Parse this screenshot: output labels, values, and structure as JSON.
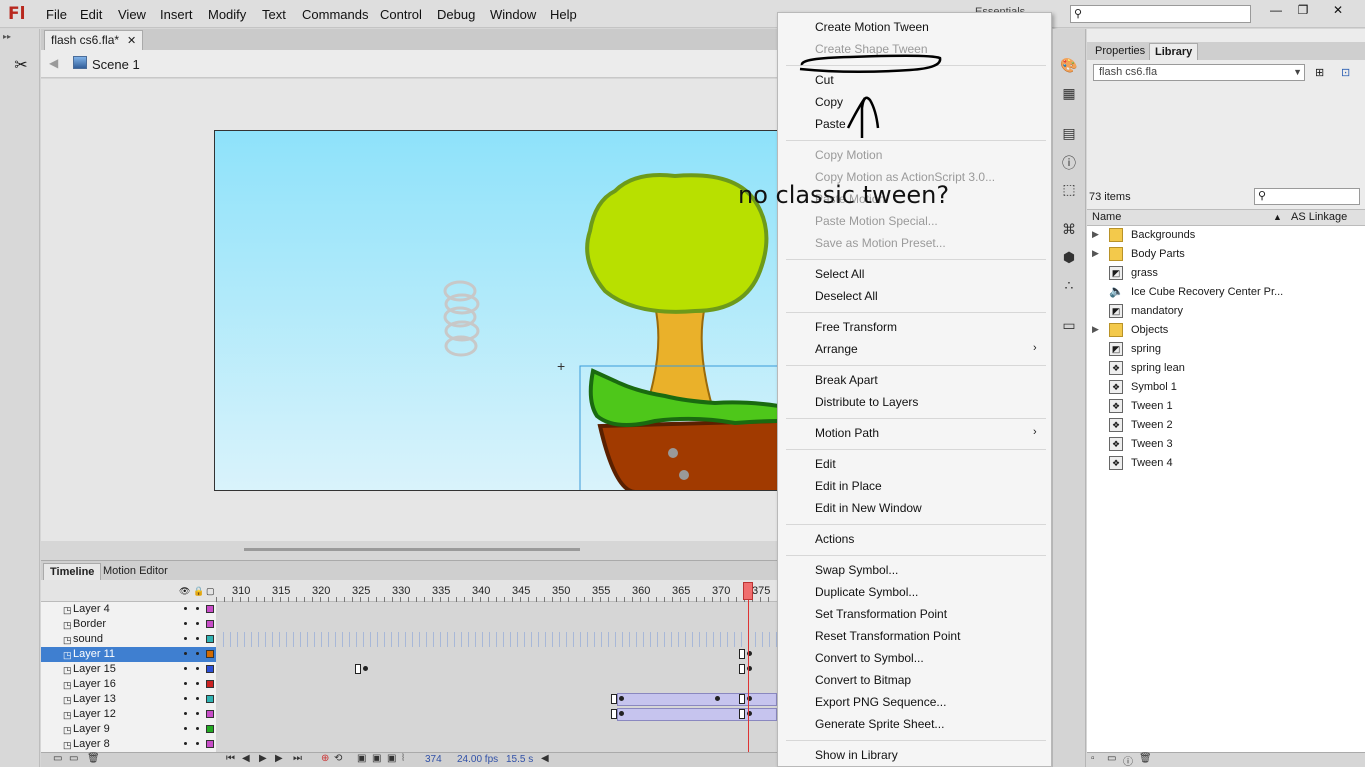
{
  "app": {
    "logo": "Fl",
    "workspace": "Essentials",
    "menu": [
      "File",
      "Edit",
      "View",
      "Insert",
      "Modify",
      "Text",
      "Commands",
      "Control",
      "Debug",
      "Window",
      "Help"
    ],
    "window_controls": [
      "—",
      "❐",
      "✕"
    ]
  },
  "document": {
    "tab_title": "flash cs6.fla*",
    "scene": "Scene 1"
  },
  "timeline": {
    "tabs": [
      "Timeline",
      "Motion Editor"
    ],
    "frame_numbers": [
      "310",
      "315",
      "320",
      "325",
      "330",
      "335",
      "340",
      "345",
      "350",
      "355",
      "360",
      "365",
      "370",
      "375"
    ],
    "layers": [
      {
        "name": "Layer 4",
        "color": "#c84cc8",
        "selected": false
      },
      {
        "name": "Border",
        "color": "#c84cc8",
        "selected": false
      },
      {
        "name": "sound",
        "color": "#2fb3b3",
        "selected": false
      },
      {
        "name": "Layer 11",
        "color": "#d46a00",
        "selected": true
      },
      {
        "name": "Layer 15",
        "color": "#2b4fd6",
        "selected": false
      },
      {
        "name": "Layer 16",
        "color": "#cc2222",
        "selected": false
      },
      {
        "name": "Layer 13",
        "color": "#2fb3b3",
        "selected": false
      },
      {
        "name": "Layer 12",
        "color": "#c84cc8",
        "selected": false
      },
      {
        "name": "Layer 9",
        "color": "#22aa22",
        "selected": false
      },
      {
        "name": "Layer 8",
        "color": "#c84cc8",
        "selected": false
      }
    ],
    "current_frame": "374",
    "fps": "24.00 fps",
    "seconds": "15.5 s"
  },
  "context_menu": {
    "items": [
      {
        "label": "Create Motion Tween",
        "disabled": false
      },
      {
        "label": "Create Shape Tween",
        "disabled": true
      },
      {
        "label": "Cut",
        "disabled": false
      },
      {
        "label": "Copy",
        "disabled": false
      },
      {
        "label": "Paste",
        "disabled": false
      },
      {
        "label": "Copy Motion",
        "disabled": true
      },
      {
        "label": "Copy Motion as ActionScript 3.0...",
        "disabled": true
      },
      {
        "label": "Paste Motion",
        "disabled": true
      },
      {
        "label": "Paste Motion Special...",
        "disabled": true
      },
      {
        "label": "Save as Motion Preset...",
        "disabled": true
      },
      {
        "label": "Select All",
        "disabled": false
      },
      {
        "label": "Deselect All",
        "disabled": false
      },
      {
        "label": "Free Transform",
        "disabled": false
      },
      {
        "label": "Arrange",
        "disabled": false,
        "submenu": true
      },
      {
        "label": "Break Apart",
        "disabled": false
      },
      {
        "label": "Distribute to Layers",
        "disabled": false
      },
      {
        "label": "Motion Path",
        "disabled": false,
        "submenu": true
      },
      {
        "label": "Edit",
        "disabled": false
      },
      {
        "label": "Edit in Place",
        "disabled": false
      },
      {
        "label": "Edit in New Window",
        "disabled": false
      },
      {
        "label": "Actions",
        "disabled": false
      },
      {
        "label": "Swap Symbol...",
        "disabled": false
      },
      {
        "label": "Duplicate Symbol...",
        "disabled": false
      },
      {
        "label": "Set Transformation Point",
        "disabled": false
      },
      {
        "label": "Reset Transformation Point",
        "disabled": false
      },
      {
        "label": "Convert to Symbol...",
        "disabled": false
      },
      {
        "label": "Convert to Bitmap",
        "disabled": false
      },
      {
        "label": "Export PNG Sequence...",
        "disabled": false
      },
      {
        "label": "Generate Sprite Sheet...",
        "disabled": false
      },
      {
        "label": "Show in Library",
        "disabled": false
      }
    ],
    "submenu_arrow": "›"
  },
  "annotation": "no classic tween?",
  "library": {
    "tabs": [
      "Properties",
      "Library"
    ],
    "file": "flash cs6.fla",
    "count": "73 items",
    "col_name": "Name",
    "col_linkage": "AS Linkage",
    "items": [
      {
        "name": "Backgrounds",
        "kind": "folder",
        "expand": true
      },
      {
        "name": "Body Parts",
        "kind": "folder",
        "expand": true
      },
      {
        "name": "grass",
        "kind": "graphic",
        "expand": false
      },
      {
        "name": "Ice Cube Recovery Center Pr...",
        "kind": "sound",
        "expand": false
      },
      {
        "name": "mandatory",
        "kind": "graphic",
        "expand": false
      },
      {
        "name": "Objects",
        "kind": "folder",
        "expand": true
      },
      {
        "name": "spring",
        "kind": "graphic",
        "expand": false
      },
      {
        "name": "spring lean",
        "kind": "movieclip",
        "expand": false
      },
      {
        "name": "Symbol 1",
        "kind": "movieclip",
        "expand": false
      },
      {
        "name": "Tween 1",
        "kind": "movieclip",
        "expand": false
      },
      {
        "name": "Tween 2",
        "kind": "movieclip",
        "expand": false
      },
      {
        "name": "Tween 3",
        "kind": "movieclip",
        "expand": false
      },
      {
        "name": "Tween 4",
        "kind": "movieclip",
        "expand": false
      }
    ]
  }
}
